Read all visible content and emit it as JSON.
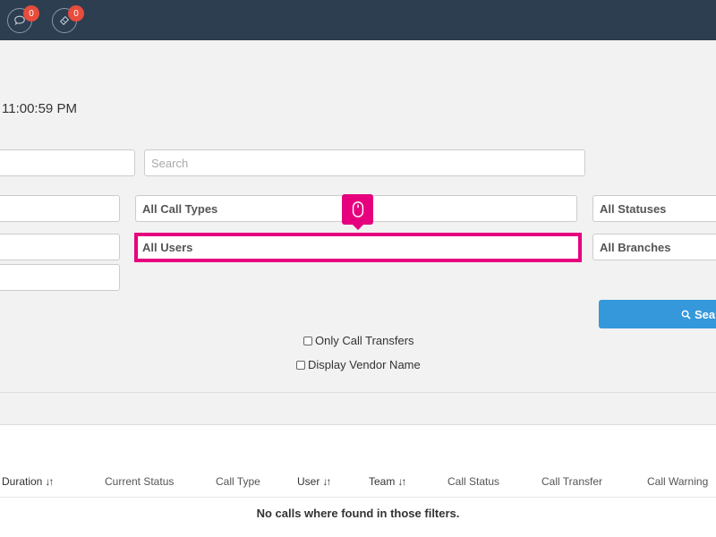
{
  "topbar": {
    "notifications": [
      {
        "icon": "chat-icon",
        "count": "0"
      },
      {
        "icon": "ticket-icon",
        "count": "0"
      }
    ]
  },
  "header": {
    "time": "11:00:59 PM"
  },
  "filters": {
    "search_placeholder": "Search",
    "call_types": "All Call Types",
    "statuses": "All Statuses",
    "users": "All Users",
    "branches": "All Branches",
    "search_button": "Sear",
    "only_transfers": "Only Call Transfers",
    "display_vendor": "Display Vendor Name"
  },
  "table": {
    "columns": [
      {
        "label": "Duration",
        "sortable": true
      },
      {
        "label": "Current Status",
        "sortable": false
      },
      {
        "label": "Call Type",
        "sortable": false
      },
      {
        "label": "User",
        "sortable": true
      },
      {
        "label": "Team",
        "sortable": true
      },
      {
        "label": "Call Status",
        "sortable": false
      },
      {
        "label": "Call Transfer",
        "sortable": false
      },
      {
        "label": "Call Warning",
        "sortable": false
      }
    ],
    "sort_glyph": "↓↑",
    "empty_message": "No calls where found in those filters."
  },
  "colors": {
    "topbar": "#2c3e50",
    "highlight": "#e6007e",
    "badge": "#e74c3c",
    "primary": "#3498db"
  }
}
